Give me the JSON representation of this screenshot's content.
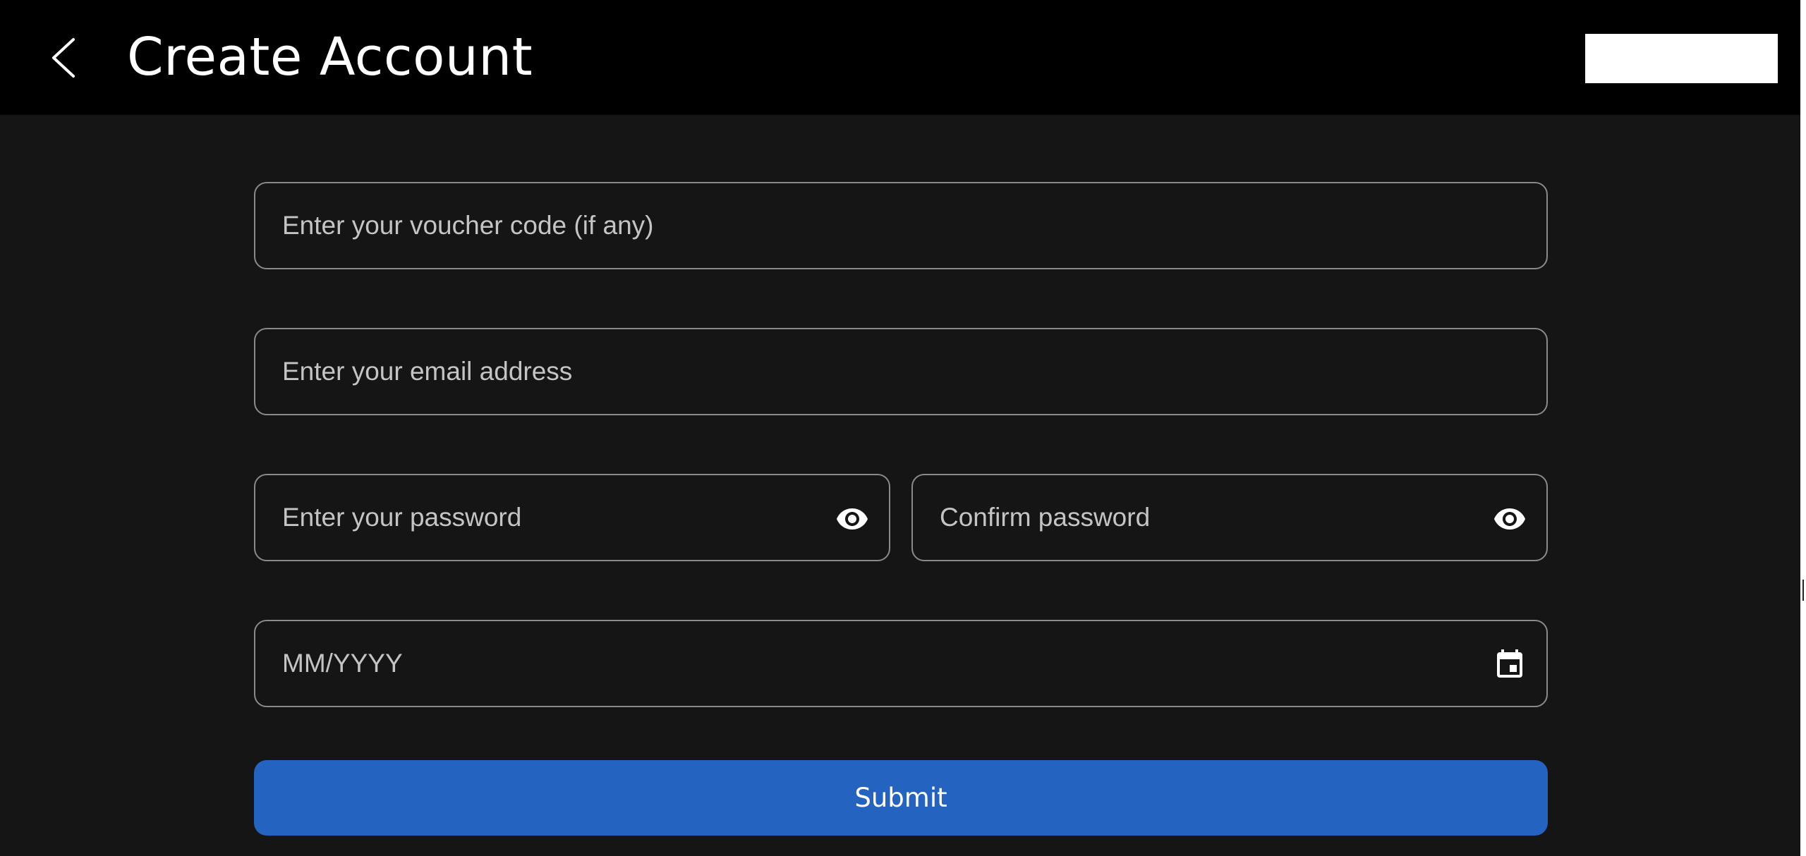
{
  "header": {
    "title": "Create Account",
    "back_icon": "chevron-left-icon"
  },
  "form": {
    "voucher": {
      "placeholder": "Enter your voucher code (if any)",
      "value": ""
    },
    "email": {
      "placeholder": "Enter your email address",
      "value": ""
    },
    "password": {
      "placeholder": "Enter your password",
      "value": "",
      "icon": "eye-icon"
    },
    "confirm_password": {
      "placeholder": "Confirm password",
      "value": "",
      "icon": "eye-icon"
    },
    "birth_date": {
      "placeholder": "MM/YYYY",
      "value": "",
      "icon": "calendar-icon"
    },
    "submit_label": "Submit"
  },
  "colors": {
    "header_bg": "#000000",
    "page_bg": "#151515",
    "accent": "#2563c0",
    "field_border": "#8a8a8a"
  }
}
